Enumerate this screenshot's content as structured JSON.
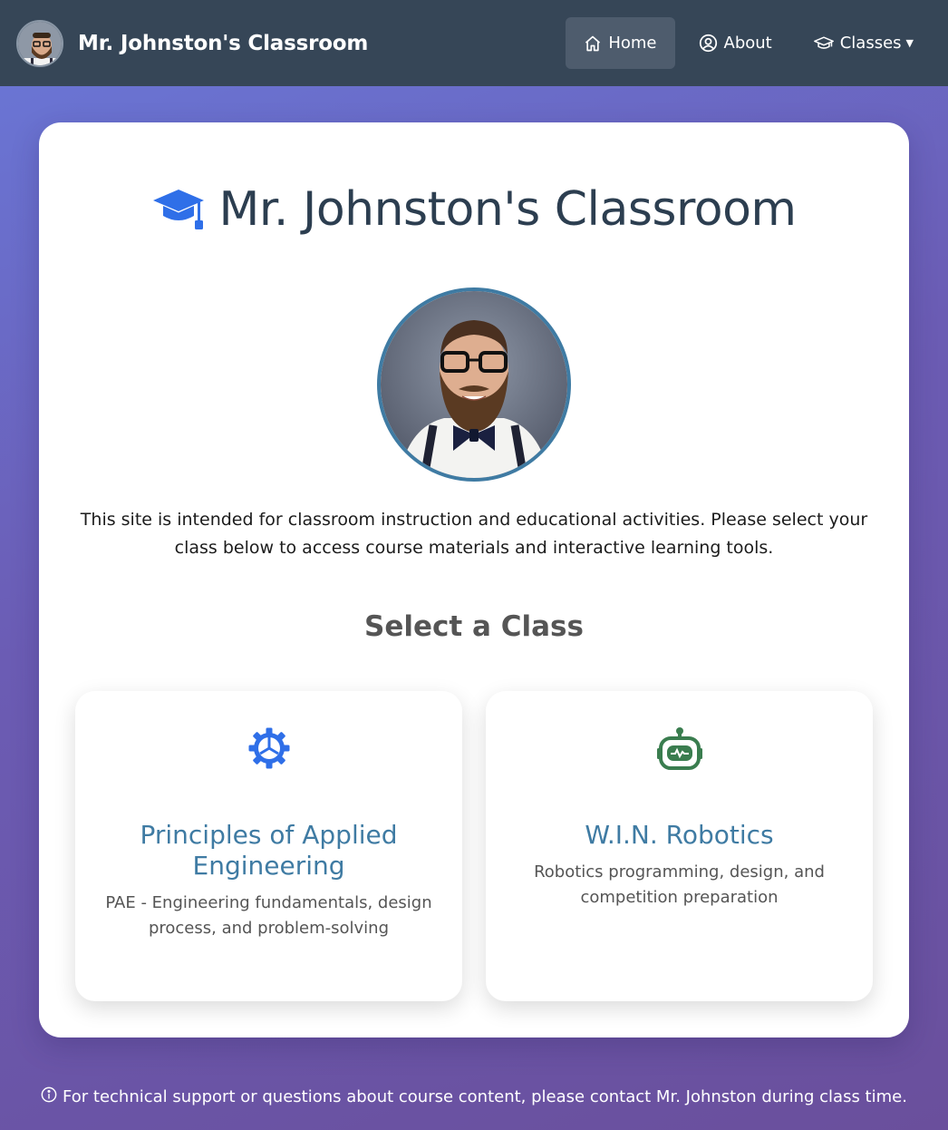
{
  "navbar": {
    "brand": "Mr. Johnston's Classroom",
    "links": [
      {
        "label": "Home",
        "icon": "home-icon",
        "active": true
      },
      {
        "label": "About",
        "icon": "user-circle-icon",
        "active": false
      },
      {
        "label": "Classes",
        "icon": "graduation-cap-icon",
        "active": false,
        "dropdown": true
      }
    ]
  },
  "hero": {
    "title": "Mr. Johnston's Classroom",
    "icon": "graduation-cap-icon"
  },
  "intro": "This site is intended for classroom instruction and educational activities. Please select your class below to access course materials and interactive learning tools.",
  "classes_section": {
    "title": "Select a Class",
    "items": [
      {
        "name": "Principles of Applied Engineering",
        "description": "PAE - Engineering fundamentals, design process, and problem-solving",
        "icon": "gear-icon",
        "icon_color": "#2f6fe8"
      },
      {
        "name": "W.I.N. Robotics",
        "description": "Robotics programming, design, and competition preparation",
        "icon": "robot-icon",
        "icon_color": "#3a7d4f"
      }
    ]
  },
  "footer": {
    "icon": "info-icon",
    "text": "For technical support or questions about course content, please contact Mr. Johnston during class time."
  },
  "colors": {
    "navbar": "#364657",
    "accent": "#3f7ba3",
    "title": "#2c3e50"
  }
}
